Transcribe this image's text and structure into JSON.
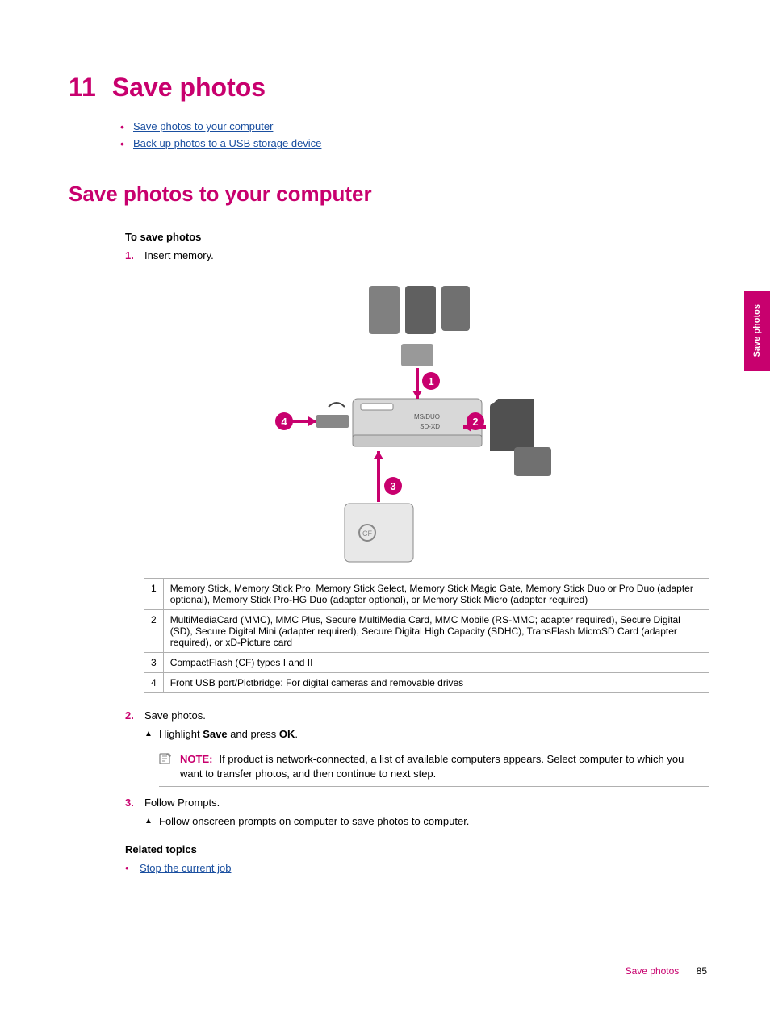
{
  "chapter": {
    "number": "11",
    "title": "Save photos"
  },
  "top_links": [
    "Save photos to your computer",
    "Back up photos to a USB storage device"
  ],
  "section_heading": "Save photos to your computer",
  "procedure_title": "To save photos",
  "steps": {
    "s1": {
      "num": "1.",
      "text": "Insert memory."
    },
    "s2": {
      "num": "2.",
      "text": "Save photos."
    },
    "s2a": {
      "pre": "Highlight ",
      "bold1": "Save",
      "mid": " and press ",
      "bold2": "OK",
      "post": "."
    },
    "s3": {
      "num": "3.",
      "text": "Follow Prompts."
    },
    "s3a": "Follow onscreen prompts on computer to save photos to computer."
  },
  "slot_labels": {
    "l1": "MS/DUO",
    "l2": "SD-XD",
    "l3": "CF"
  },
  "card_table": [
    {
      "n": "1",
      "desc": "Memory Stick, Memory Stick Pro, Memory Stick Select, Memory Stick Magic Gate, Memory Stick Duo or Pro Duo (adapter optional), Memory Stick Pro-HG Duo (adapter optional), or Memory Stick Micro (adapter required)"
    },
    {
      "n": "2",
      "desc": "MultiMediaCard (MMC), MMC Plus, Secure MultiMedia Card, MMC Mobile (RS-MMC; adapter required), Secure Digital (SD), Secure Digital Mini (adapter required), Secure Digital High Capacity (SDHC), TransFlash MicroSD Card (adapter required), or xD-Picture card"
    },
    {
      "n": "3",
      "desc": "CompactFlash (CF) types I and II"
    },
    {
      "n": "4",
      "desc": "Front USB port/Pictbridge: For digital cameras and removable drives"
    }
  ],
  "note": {
    "label": "NOTE:",
    "text": "If product is network-connected, a list of available computers appears. Select computer to which you want to transfer photos, and then continue to next step."
  },
  "related": {
    "heading": "Related topics",
    "links": [
      "Stop the current job"
    ]
  },
  "side_tab": "Save photos",
  "footer": {
    "text": "Save photos",
    "page": "85"
  }
}
